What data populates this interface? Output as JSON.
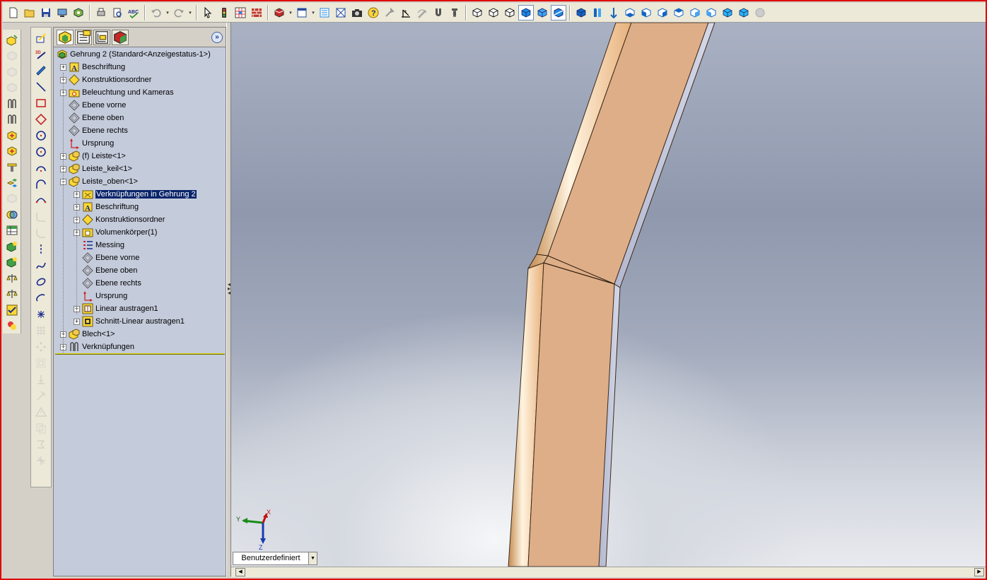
{
  "app": {
    "accent_color": "#e00000",
    "selection_color": "#0a246a"
  },
  "toolbar": {
    "items": [
      {
        "icon": "new-document-icon"
      },
      {
        "icon": "open-folder-icon"
      },
      {
        "icon": "save-icon"
      },
      {
        "icon": "print-preview-icon"
      },
      {
        "icon": "options-icon"
      },
      {
        "icon": "print-icon"
      },
      {
        "icon": "page-setup-icon"
      },
      {
        "icon": "spelling-icon",
        "text": "ABC"
      },
      {
        "icon": "undo-icon"
      },
      {
        "icon": "redo-icon"
      },
      {
        "icon": "select-arrow-icon"
      },
      {
        "icon": "rebuild-icon"
      },
      {
        "icon": "grid-icon"
      },
      {
        "icon": "brick-icon"
      },
      {
        "icon": "appearance-icon"
      },
      {
        "icon": "view-orientation-icon"
      },
      {
        "icon": "property-manager-icon"
      },
      {
        "icon": "zoom-fit-icon"
      },
      {
        "icon": "camera-icon"
      },
      {
        "icon": "help-icon"
      },
      {
        "icon": "tools-icon"
      },
      {
        "icon": "measure-icon"
      },
      {
        "icon": "sketch-tool-icon"
      },
      {
        "icon": "magnet-icon"
      },
      {
        "icon": "screw-icon"
      },
      {
        "icon": "wireframe-icon"
      },
      {
        "icon": "hidden-lines-icon"
      },
      {
        "icon": "hidden-removed-icon"
      },
      {
        "icon": "shaded-edges-icon",
        "pressed": true
      },
      {
        "icon": "shaded-icon"
      },
      {
        "icon": "section-view-icon",
        "pressed": true
      },
      {
        "icon": "view-front-icon"
      },
      {
        "icon": "view-back-icon"
      },
      {
        "icon": "view-top-icon"
      },
      {
        "icon": "view-bottom-icon"
      },
      {
        "icon": "view-left-icon"
      },
      {
        "icon": "view-right-icon"
      },
      {
        "icon": "view-iso-icon"
      },
      {
        "icon": "view-trimetric-icon"
      },
      {
        "icon": "view-dimetric-icon"
      },
      {
        "icon": "view-normal-icon"
      },
      {
        "icon": "view-cube-icon"
      },
      {
        "icon": "disabled-circle-icon"
      }
    ]
  },
  "feature_manager": {
    "tabs": [
      {
        "icon": "feature-tree-tab-icon"
      },
      {
        "icon": "property-tab-icon"
      },
      {
        "icon": "configuration-tab-icon"
      },
      {
        "icon": "display-tab-icon"
      }
    ],
    "root": {
      "label": "Gehrung 2  (Standard<Anzeigestatus-1>)",
      "icon": "assembly-icon"
    },
    "items": [
      {
        "label": "Beschriftung",
        "icon": "annotation-icon",
        "level": 1,
        "expander": "+"
      },
      {
        "label": "Konstruktionsordner",
        "icon": "design-folder-icon",
        "level": 1,
        "expander": "+"
      },
      {
        "label": "Beleuchtung und Kameras",
        "icon": "lights-icon",
        "level": 1,
        "expander": "+"
      },
      {
        "label": "Ebene vorne",
        "icon": "plane-icon",
        "level": 1,
        "expander": ""
      },
      {
        "label": "Ebene oben",
        "icon": "plane-icon",
        "level": 1,
        "expander": ""
      },
      {
        "label": "Ebene rechts",
        "icon": "plane-icon",
        "level": 1,
        "expander": ""
      },
      {
        "label": "Ursprung",
        "icon": "origin-icon",
        "level": 1,
        "expander": ""
      },
      {
        "label": "(f) Leiste<1>",
        "icon": "part-icon",
        "level": 1,
        "expander": "+"
      },
      {
        "label": "Leiste_keil<1>",
        "icon": "part-icon",
        "level": 1,
        "expander": "+"
      },
      {
        "label": "Leiste_oben<1>",
        "icon": "part-icon",
        "level": 1,
        "expander": "−"
      },
      {
        "label": "Verknüpfungen in Gehrung 2",
        "icon": "mates-folder-icon",
        "level": 2,
        "expander": "+",
        "selected": true
      },
      {
        "label": "Beschriftung",
        "icon": "annotation-icon",
        "level": 2,
        "expander": "+"
      },
      {
        "label": "Konstruktionsordner",
        "icon": "design-folder-icon",
        "level": 2,
        "expander": "+"
      },
      {
        "label": "Volumenkörper(1)",
        "icon": "solid-bodies-icon",
        "level": 2,
        "expander": "+"
      },
      {
        "label": "Messing",
        "icon": "material-icon",
        "level": 2,
        "expander": ""
      },
      {
        "label": "Ebene vorne",
        "icon": "plane-icon",
        "level": 2,
        "expander": ""
      },
      {
        "label": "Ebene oben",
        "icon": "plane-icon",
        "level": 2,
        "expander": ""
      },
      {
        "label": "Ebene rechts",
        "icon": "plane-icon",
        "level": 2,
        "expander": ""
      },
      {
        "label": "Ursprung",
        "icon": "origin-icon",
        "level": 2,
        "expander": ""
      },
      {
        "label": "Linear austragen1",
        "icon": "extrude-icon",
        "level": 2,
        "expander": "+"
      },
      {
        "label": "Schnitt-Linear austragen1",
        "icon": "cut-extrude-icon",
        "level": 2,
        "expander": "+"
      },
      {
        "label": "Blech<1>",
        "icon": "part-icon",
        "level": 1,
        "expander": "+"
      },
      {
        "label": "Verknüpfungen",
        "icon": "mates-icon",
        "level": 1,
        "expander": "+"
      }
    ]
  },
  "viewport": {
    "triad": {
      "x_label": "X",
      "y_label": "Y",
      "z_label": "Z"
    },
    "view_select": {
      "value": "Benutzerdefiniert"
    }
  }
}
